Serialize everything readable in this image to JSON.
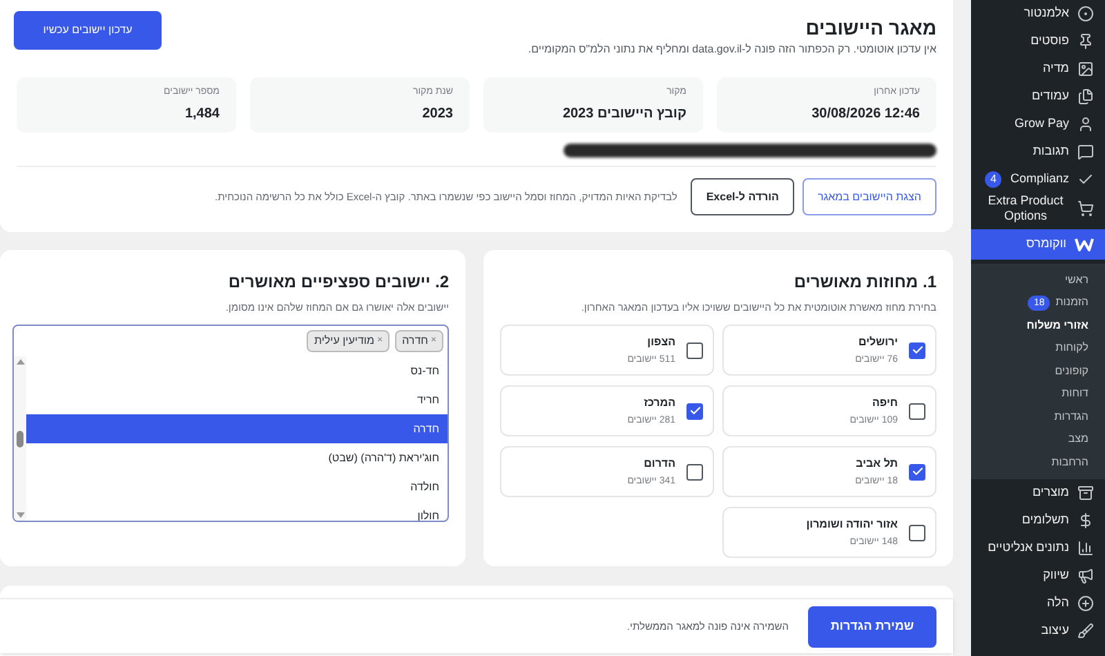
{
  "sidebar": {
    "items": [
      {
        "label": "אלמנטור"
      },
      {
        "label": "פוסטים"
      },
      {
        "label": "מדיה"
      },
      {
        "label": "עמודים"
      },
      {
        "label": "Grow Pay"
      },
      {
        "label": "תגובות"
      },
      {
        "label": "Complianz",
        "badge": "4"
      },
      {
        "label": "Extra Product Options"
      },
      {
        "label": "ווקומרס",
        "selected": true,
        "children": [
          {
            "label": "ראשי",
            "selected": false
          },
          {
            "label": "הזמנות",
            "badge": "18",
            "selected": false
          },
          {
            "label": "אזורי משלוח",
            "selected": true
          },
          {
            "label": "לקוחות",
            "selected": false
          },
          {
            "label": "קופונים",
            "selected": false
          },
          {
            "label": "דוחות",
            "selected": false
          },
          {
            "label": "הגדרות",
            "selected": false
          },
          {
            "label": "מצב",
            "selected": false
          },
          {
            "label": "הרחבות",
            "selected": false
          }
        ]
      },
      {
        "label": "מוצרים"
      },
      {
        "label": "תשלומים"
      },
      {
        "label": "נתונים אנליטיים"
      },
      {
        "label": "שיווק"
      },
      {
        "label": "הלה"
      },
      {
        "label": "עיצוב"
      }
    ]
  },
  "database": {
    "title": "מאגר היישובים",
    "description": "אין עדכון אוטומטי. רק הכפתור הזה פונה ל-data.gov.il ומחליף את נתוני הלמ\"ס המקומיים.",
    "update_button": "עדכון יישובים עכשיו",
    "stats": [
      {
        "label": "עדכון אחרון",
        "value": "12:46 30/08/2026"
      },
      {
        "label": "מקור",
        "value": "קובץ היישובים 2023"
      },
      {
        "label": "שנת מקור",
        "value": "2023"
      },
      {
        "label": "מספר יישובים",
        "value": "1,484"
      }
    ],
    "show_button": "הצגת היישובים במאגר",
    "excel_button": "הורדה ל-Excel",
    "note": "לבדיקת האיות המדויק, המחוז וסמל היישוב כפי שנשמרו באתר. קובץ ה-Excel כולל את כל הרשימה הנוכחית."
  },
  "districts": {
    "title": "1. מחוזות מאושרים",
    "description": "בחירת מחוז מאשרת אוטומטית את כל היישובים ששויכו אליו בעדכון המאגר האחרון.",
    "items": [
      {
        "name": "ירושלים",
        "count": "76 יישובים",
        "checked": true
      },
      {
        "name": "הצפון",
        "count": "511 יישובים",
        "checked": false
      },
      {
        "name": "חיפה",
        "count": "109 יישובים",
        "checked": false
      },
      {
        "name": "המרכז",
        "count": "281 יישובים",
        "checked": true
      },
      {
        "name": "תל אביב",
        "count": "18 יישובים",
        "checked": true
      },
      {
        "name": "הדרום",
        "count": "341 יישובים",
        "checked": false
      },
      {
        "name": "אזור יהודה ושומרון",
        "count": "148 יישובים",
        "checked": false
      }
    ]
  },
  "settlements": {
    "title": "2. יישובים ספציפיים מאושרים",
    "description": "יישובים אלה יאושרו גם אם המחוז שלהם אינו מסומן.",
    "tags": [
      {
        "label": "חדרה",
        "remove": "×"
      },
      {
        "label": "מודיעין עילית",
        "remove": "×"
      }
    ],
    "options": [
      {
        "label": "חד-נס",
        "selected": false
      },
      {
        "label": "חריד",
        "selected": false
      },
      {
        "label": "חדרה",
        "selected": true
      },
      {
        "label": "חוג'יראת (ד'הרה) (שבט)",
        "selected": false
      },
      {
        "label": "חולדה",
        "selected": false
      },
      {
        "label": "חולון",
        "selected": false
      }
    ]
  },
  "footer": {
    "save_button": "שמירת הגדרות",
    "note": "השמירה אינה פונה למאגר הממשלתי."
  }
}
